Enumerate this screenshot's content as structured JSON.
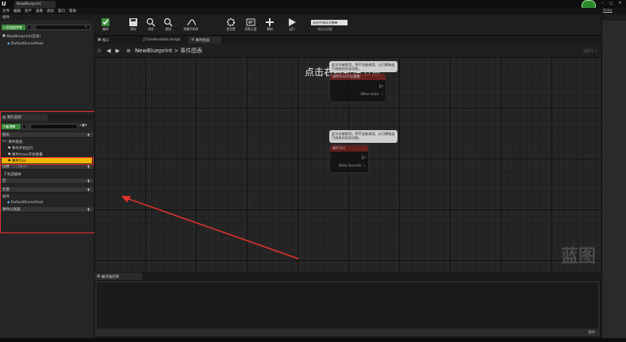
{
  "window": {
    "tab_title": "NewBlueprint",
    "search_label": "Actor",
    "controls": [
      "–",
      "◻",
      "✕"
    ]
  },
  "menu": [
    "文件",
    "编辑",
    "资产",
    "查看",
    "调试",
    "窗口",
    "帮助"
  ],
  "toolbar": {
    "buttons": [
      "编译",
      "保存",
      "浏览",
      "查找",
      "隐藏不相关",
      "类设置",
      "类默认值",
      "模拟",
      "运行"
    ],
    "debug_select": "未选中调试对象▼",
    "debug_label": "调试过滤器"
  },
  "left_top": {
    "tab": "组件",
    "add_button": "+添加组件▼",
    "search_placeholder": "搜索",
    "item_self": "NewBlueprint(自身)",
    "item_root": "DefaultSceneRoot"
  },
  "my_blueprint": {
    "tab": "我的蓝图",
    "new_button": "+新增▼",
    "search_placeholder": "搜索",
    "sections": {
      "graphs": "图表",
      "event_graph": "事件图表",
      "functions": "函数",
      "functions_count": "(1可覆盖)",
      "macros": "宏",
      "variables": "变量",
      "components": "组件",
      "event_dispatchers": "事件分发器"
    },
    "events": [
      "事件开始运行",
      "事件Actor开始重叠",
      "事件Tick"
    ],
    "construction": "构造脚本",
    "component_item": "DefaultSceneRoot"
  },
  "graph_tabs": [
    "视口",
    "Construction Script",
    "事件图表"
  ],
  "graph": {
    "breadcrumb_root": "NewBlueprint",
    "breadcrumb_sep": ">",
    "breadcrumb_current": "事件图表",
    "zoom": "缩放1:1",
    "hint": "点击右键新建节点",
    "watermark": "蓝图",
    "node1": {
      "comment": "此节点被禁用，将不会被调用。从引脚拖出引线来启用该功能。",
      "title": "事件Actor开始重叠",
      "pin_out": "Other Actor"
    },
    "node2": {
      "comment": "此节点被禁用，将不会被调用。从引脚拖出引线来启用该功能。",
      "title": "事件Tick",
      "pin_out": "Delta Seconds"
    }
  },
  "bottom": {
    "tab": "编译器结果",
    "footer": "清除"
  },
  "colors": {
    "highlight": "#f2b400",
    "annotation": "#e53030",
    "node_header": "#7a1e1e",
    "exec_pin": "#ffffff",
    "data_pin": "#3bd36a"
  }
}
